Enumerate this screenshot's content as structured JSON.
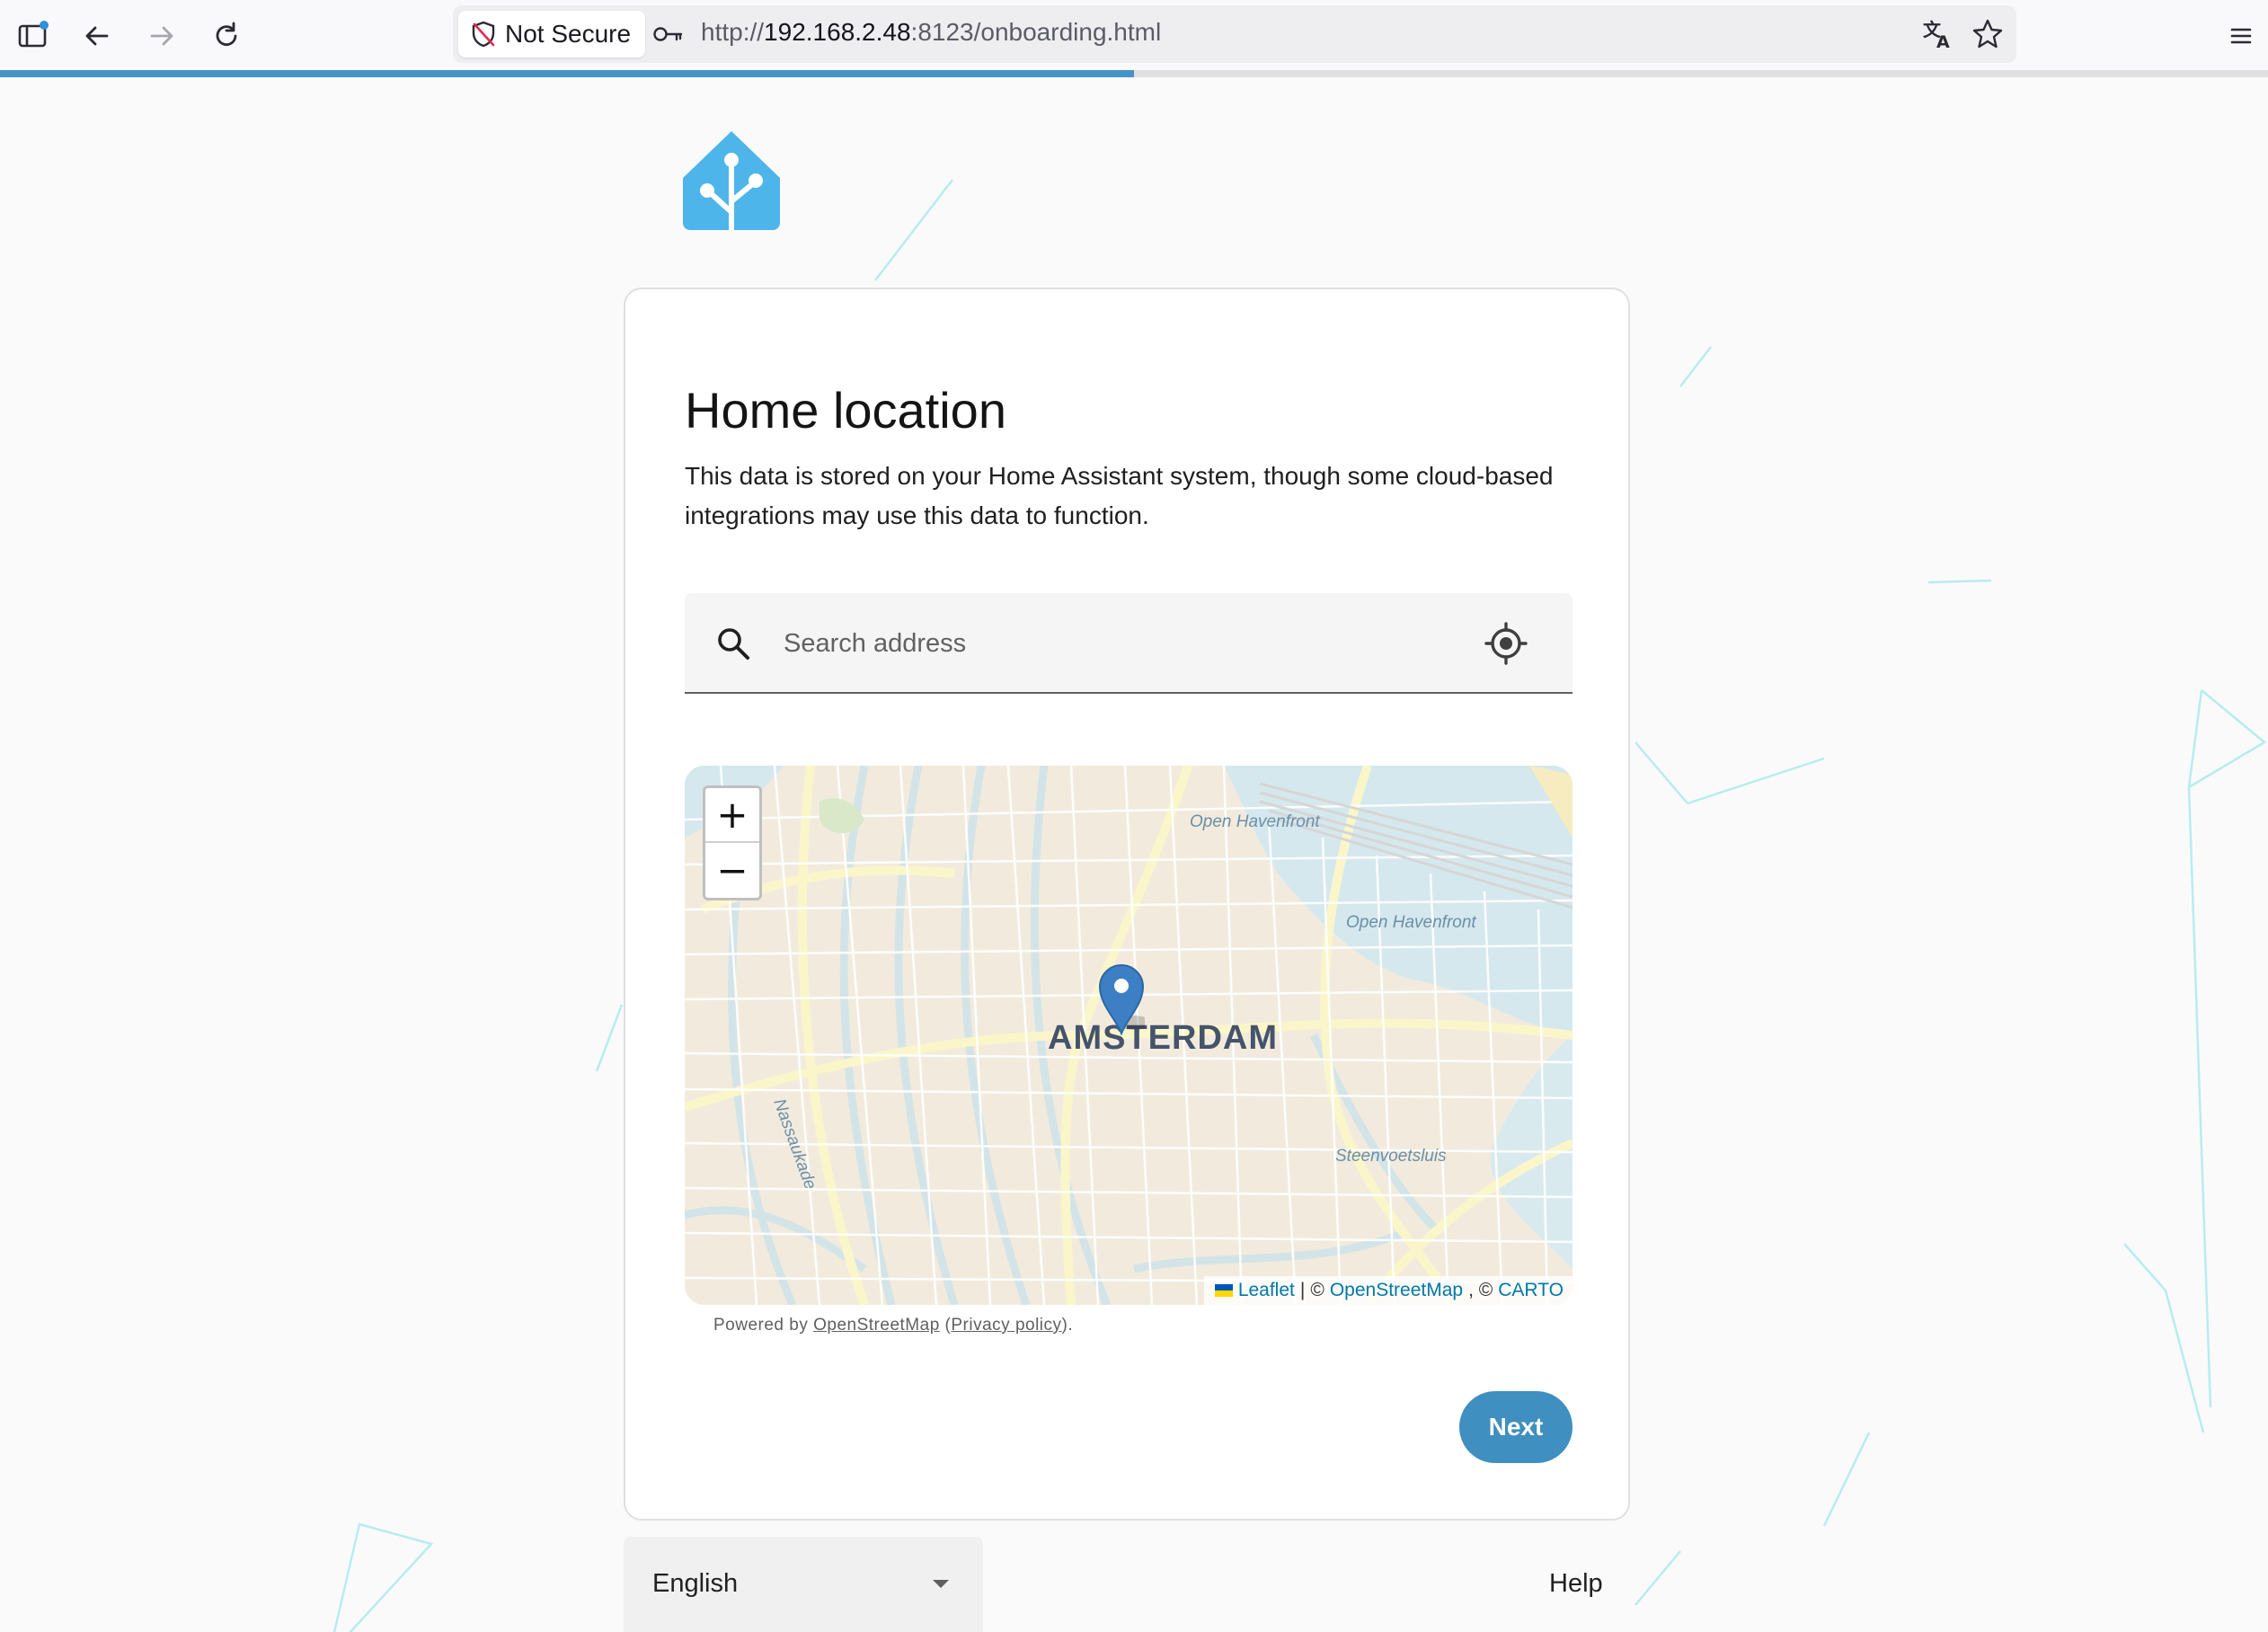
{
  "browser": {
    "security_label": "Not Secure",
    "url_scheme": "http://",
    "url_host": "192.168.2.48",
    "url_rest": ":8123/onboarding.html",
    "page_load_progress_percent": 50
  },
  "icons": {
    "sidebar": "sidebar-icon",
    "back": "arrow-left-icon",
    "forward": "arrow-right-icon",
    "reload": "reload-icon",
    "shield": "shield-slash-icon",
    "key": "key-icon",
    "translate": "translate-icon",
    "bookmark": "star-icon",
    "menu": "hamburger-icon",
    "search": "magnify-icon",
    "locate": "crosshairs-gps-icon",
    "marker": "map-marker-icon",
    "caret": "caret-down-icon"
  },
  "colors": {
    "primary": "#3f8fc0",
    "logo": "#4db5ea",
    "progress": "#4593c8"
  },
  "onboarding": {
    "title": "Home location",
    "description": "This data is stored on your Home Assistant system, though some cloud-based integrations may use this data to function.",
    "search": {
      "placeholder": "Search address"
    },
    "map": {
      "zoom_in": "+",
      "zoom_out": "−",
      "city_label": "AMSTERDAM",
      "labels": {
        "open_havenfront_1": "Open Havenfront",
        "open_havenfront_2": "Open Havenfront",
        "nassaukade": "Nassaukade",
        "steenvoetsluis": "Steenvoetsluis"
      },
      "attribution": {
        "leaflet": "Leaflet",
        "sep": "|",
        "copy1": "©",
        "osm": "OpenStreetMap",
        "copy2": ", ©",
        "carto": "CARTO"
      }
    },
    "powered_by": {
      "prefix": "Powered by ",
      "osm": "OpenStreetMap",
      "open_paren": " (",
      "privacy": "Privacy policy",
      "close": ")."
    },
    "next_label": "Next"
  },
  "footer": {
    "language": "English",
    "help": "Help"
  }
}
